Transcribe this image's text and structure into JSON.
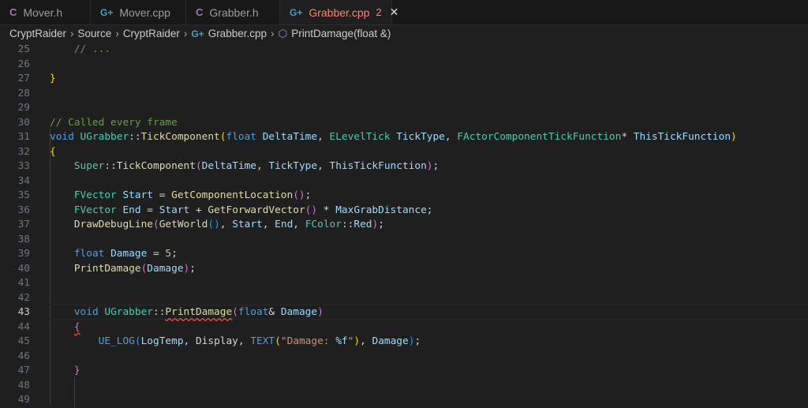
{
  "tabs": [
    {
      "label": "Mover.h",
      "icon": "c-header-icon",
      "active": false
    },
    {
      "label": "Mover.cpp",
      "icon": "cpp-file-icon",
      "active": false
    },
    {
      "label": "Grabber.h",
      "icon": "c-header-icon",
      "active": false
    },
    {
      "label": "Grabber.cpp",
      "icon": "cpp-file-icon",
      "active": true,
      "problems": "2"
    }
  ],
  "breadcrumb": [
    "CryptRaider",
    "Source",
    "CryptRaider",
    "Grabber.cpp",
    "PrintDamage(float &)"
  ],
  "current_line": 43,
  "lines": [
    {
      "n": 25,
      "t": [
        [
          "    ",
          "p"
        ],
        [
          "// ...",
          "c"
        ]
      ]
    },
    {
      "n": 26,
      "t": []
    },
    {
      "n": 27,
      "t": [
        [
          "}",
          "b1"
        ]
      ]
    },
    {
      "n": 28,
      "t": []
    },
    {
      "n": 29,
      "t": []
    },
    {
      "n": 30,
      "t": [
        [
          "// Called every frame",
          "c"
        ]
      ]
    },
    {
      "n": 31,
      "t": [
        [
          "void ",
          "k"
        ],
        [
          "UGrabber",
          "t"
        ],
        [
          "::",
          "p"
        ],
        [
          "TickComponent",
          "f"
        ],
        [
          "(",
          "b1"
        ],
        [
          "float ",
          "k"
        ],
        [
          "DeltaTime",
          "v"
        ],
        [
          ", ",
          "p"
        ],
        [
          "ELevelTick ",
          "t"
        ],
        [
          "TickType",
          "v"
        ],
        [
          ", ",
          "p"
        ],
        [
          "FActorComponentTickFunction",
          "t"
        ],
        [
          "* ",
          "p"
        ],
        [
          "ThisTickFunction",
          "v"
        ],
        [
          ")",
          "b1"
        ]
      ]
    },
    {
      "n": 32,
      "t": [
        [
          "{",
          "b1"
        ]
      ]
    },
    {
      "n": 33,
      "t": [
        [
          "    ",
          "p"
        ],
        [
          "Super",
          "t"
        ],
        [
          "::",
          "p"
        ],
        [
          "TickComponent",
          "f"
        ],
        [
          "(",
          "b2"
        ],
        [
          "DeltaTime",
          "v"
        ],
        [
          ", ",
          "p"
        ],
        [
          "TickType",
          "v"
        ],
        [
          ", ",
          "p"
        ],
        [
          "ThisTickFunction",
          "v"
        ],
        [
          ")",
          "b2"
        ],
        [
          ";",
          "p"
        ]
      ]
    },
    {
      "n": 34,
      "t": []
    },
    {
      "n": 35,
      "t": [
        [
          "    ",
          "p"
        ],
        [
          "FVector ",
          "t"
        ],
        [
          "Start",
          "v"
        ],
        [
          " = ",
          "p"
        ],
        [
          "GetComponentLocation",
          "f"
        ],
        [
          "()",
          "b2"
        ],
        [
          ";",
          "p"
        ]
      ]
    },
    {
      "n": 36,
      "t": [
        [
          "    ",
          "p"
        ],
        [
          "FVector ",
          "t"
        ],
        [
          "End",
          "v"
        ],
        [
          " = ",
          "p"
        ],
        [
          "Start",
          "v"
        ],
        [
          " + ",
          "p"
        ],
        [
          "GetForwardVector",
          "f"
        ],
        [
          "()",
          "b2"
        ],
        [
          " * ",
          "p"
        ],
        [
          "MaxGrabDistance",
          "v"
        ],
        [
          ";",
          "p"
        ]
      ]
    },
    {
      "n": 37,
      "t": [
        [
          "    ",
          "p"
        ],
        [
          "DrawDebugLine",
          "f"
        ],
        [
          "(",
          "b2"
        ],
        [
          "GetWorld",
          "f"
        ],
        [
          "()",
          "b3"
        ],
        [
          ", ",
          "p"
        ],
        [
          "Start",
          "v"
        ],
        [
          ", ",
          "p"
        ],
        [
          "End",
          "v"
        ],
        [
          ", ",
          "p"
        ],
        [
          "FColor",
          "t"
        ],
        [
          "::",
          "p"
        ],
        [
          "Red",
          "v"
        ],
        [
          ")",
          "b2"
        ],
        [
          ";",
          "p"
        ]
      ]
    },
    {
      "n": 38,
      "t": []
    },
    {
      "n": 39,
      "t": [
        [
          "    ",
          "p"
        ],
        [
          "float ",
          "k"
        ],
        [
          "Damage",
          "v"
        ],
        [
          " = ",
          "p"
        ],
        [
          "5",
          "n"
        ],
        [
          ";",
          "p"
        ]
      ]
    },
    {
      "n": 40,
      "t": [
        [
          "    ",
          "p"
        ],
        [
          "PrintDamage",
          "f"
        ],
        [
          "(",
          "b2"
        ],
        [
          "Damage",
          "v"
        ],
        [
          ")",
          "b2"
        ],
        [
          ";",
          "p"
        ]
      ]
    },
    {
      "n": 41,
      "t": []
    },
    {
      "n": 42,
      "t": []
    },
    {
      "n": 43,
      "t": [
        [
          "    ",
          "p"
        ],
        [
          "void ",
          "k"
        ],
        [
          "UGrabber",
          "t"
        ],
        [
          "::",
          "p"
        ],
        [
          "PrintDamage",
          "f sq"
        ],
        [
          "(",
          "b2"
        ],
        [
          "float",
          "k"
        ],
        [
          "& ",
          "p"
        ],
        [
          "Damage",
          "v"
        ],
        [
          ")",
          "b2"
        ]
      ]
    },
    {
      "n": 44,
      "t": [
        [
          "    ",
          "p"
        ],
        [
          "{",
          "b2 sq"
        ]
      ]
    },
    {
      "n": 45,
      "t": [
        [
          "        ",
          "p"
        ],
        [
          "UE_LOG",
          "k"
        ],
        [
          "(",
          "b3"
        ],
        [
          "LogTemp",
          "v"
        ],
        [
          ", ",
          "p"
        ],
        [
          "Display",
          "p"
        ],
        [
          ", ",
          "p"
        ],
        [
          "TEXT",
          "k"
        ],
        [
          "(",
          "b1"
        ],
        [
          "\"Damage: ",
          "s"
        ],
        [
          "%f",
          "e"
        ],
        [
          "\"",
          "s"
        ],
        [
          ")",
          "b1"
        ],
        [
          ", ",
          "p"
        ],
        [
          "Damage",
          "v"
        ],
        [
          ")",
          "b3"
        ],
        [
          ";",
          "p"
        ]
      ]
    },
    {
      "n": 46,
      "t": []
    },
    {
      "n": 47,
      "t": [
        [
          "    ",
          "p"
        ],
        [
          "}",
          "b2"
        ]
      ]
    },
    {
      "n": 48,
      "t": []
    },
    {
      "n": 49,
      "t": []
    }
  ]
}
